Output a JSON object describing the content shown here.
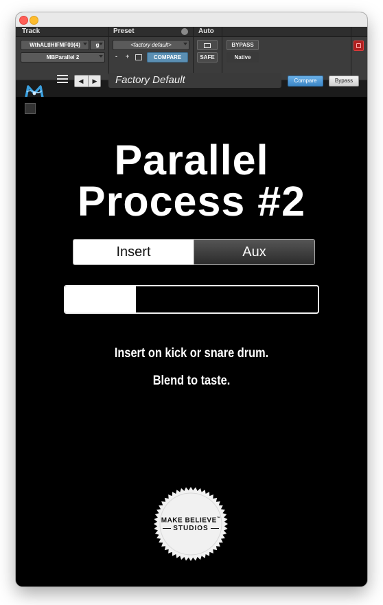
{
  "pt_header": {
    "track_label": "Track",
    "preset_label": "Preset",
    "auto_label": "Auto",
    "track_name": "WthALtIHIFMF09(4)",
    "track_group": "g",
    "insert_name": "MBParallel 2",
    "preset_value": "<factory default>",
    "minus_label": "-",
    "plus_label": "+",
    "compare_label": "COMPARE",
    "bypass_label": "BYPASS",
    "safe_label": "SAFE",
    "native_label": "Native"
  },
  "plugin_bar": {
    "preset_name": "Factory Default",
    "compare_label": "Compare",
    "bypass_label": "Bypass"
  },
  "main": {
    "title_line1": "Parallel",
    "title_line2": "Process #2",
    "mode_options": [
      "Insert",
      "Aux"
    ],
    "selected_mode": "Insert",
    "blend_level": 0.28,
    "note_line1": "Insert on kick or snare drum.",
    "note_line2": "Blend to taste."
  },
  "brand": {
    "line1": "MAKE BELIEVE",
    "tm": "™",
    "line2": "STUDIOS"
  },
  "colors": {
    "background": "#000000",
    "accent_blue": "#3d87c6",
    "power_red": "#b02020"
  }
}
